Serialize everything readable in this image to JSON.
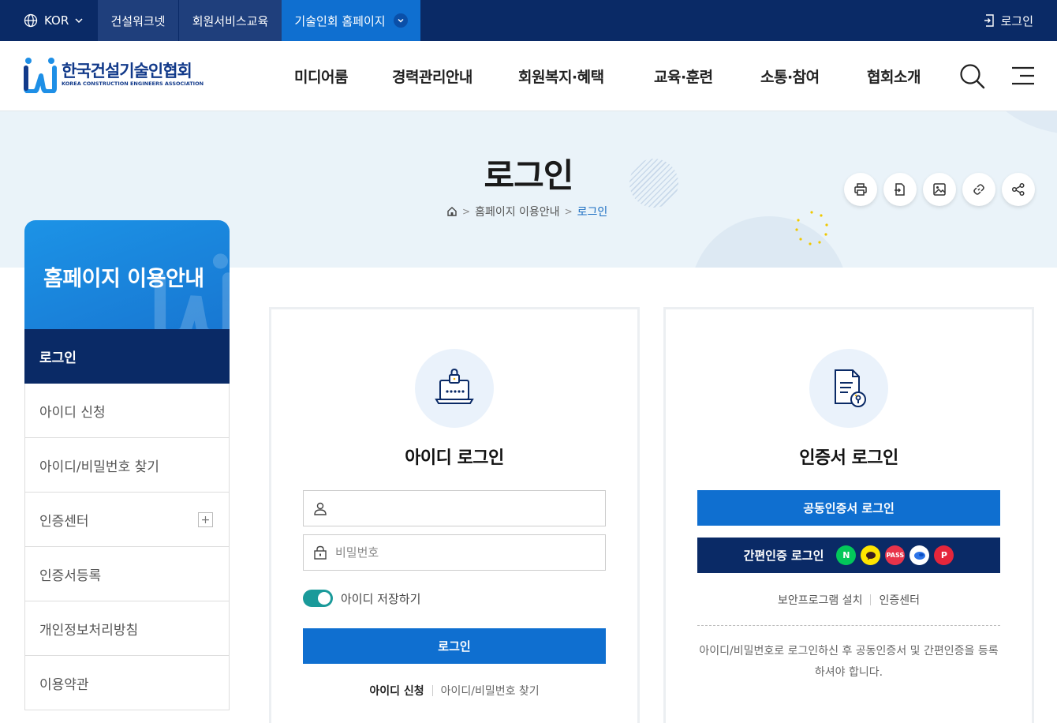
{
  "topbar": {
    "lang_label": "KOR",
    "tabs": [
      "건설워크넷",
      "회원서비스교육",
      "기술인회 홈페이지"
    ],
    "login_label": "로그인"
  },
  "header": {
    "logo_ko": "한국건설기술인협회",
    "logo_en": "KOREA CONSTRUCTION ENGINEERS ASSOCIATION",
    "nav": [
      "미디어룸",
      "경력관리안내",
      "회원복지·혜택",
      "교육·훈련",
      "소통·참여",
      "협회소개"
    ]
  },
  "visual": {
    "title": "로그인",
    "breadcrumb": [
      "홈페이지 이용안내",
      "로그인"
    ]
  },
  "sidebar": {
    "title": "홈페이지 이용안내",
    "items": [
      "로그인",
      "아이디 신청",
      "아이디/비밀번호 찾기",
      "인증센터",
      "인증서등록",
      "개인정보처리방침",
      "이용약관"
    ]
  },
  "id_login": {
    "title": "아이디 로그인",
    "id_placeholder": "",
    "pw_placeholder": "비밀번호",
    "remember_label": "아이디 저장하기",
    "remember_on": true,
    "submit_label": "로그인",
    "link_signup": "아이디 신청",
    "link_find": "아이디/비밀번호 찾기"
  },
  "cert_login": {
    "title": "인증서 로그인",
    "joint_cert_label": "공동인증서 로그인",
    "simple_auth_label": "간편인증 로그인",
    "auth_icons": [
      {
        "name": "naver-icon",
        "text": "N",
        "color": "#03c75a"
      },
      {
        "name": "kakao-icon",
        "text": "",
        "color": "#fee500"
      },
      {
        "name": "pass-icon",
        "text": "PASS",
        "color": "#e8334a"
      },
      {
        "name": "toss-icon",
        "text": "",
        "color": "#ffffff"
      },
      {
        "name": "payco-icon",
        "text": "P",
        "color": "#e5263b"
      }
    ],
    "link_security": "보안프로그램 설치",
    "link_center": "인증센터",
    "notice": "아이디/비밀번호로 로그인하신 후 공동인증서 및 간편인증을 등록하셔야 합니다."
  },
  "colors": {
    "navy": "#0a2a66",
    "blue": "#0f6fd0",
    "teal": "#1a9a9a"
  }
}
